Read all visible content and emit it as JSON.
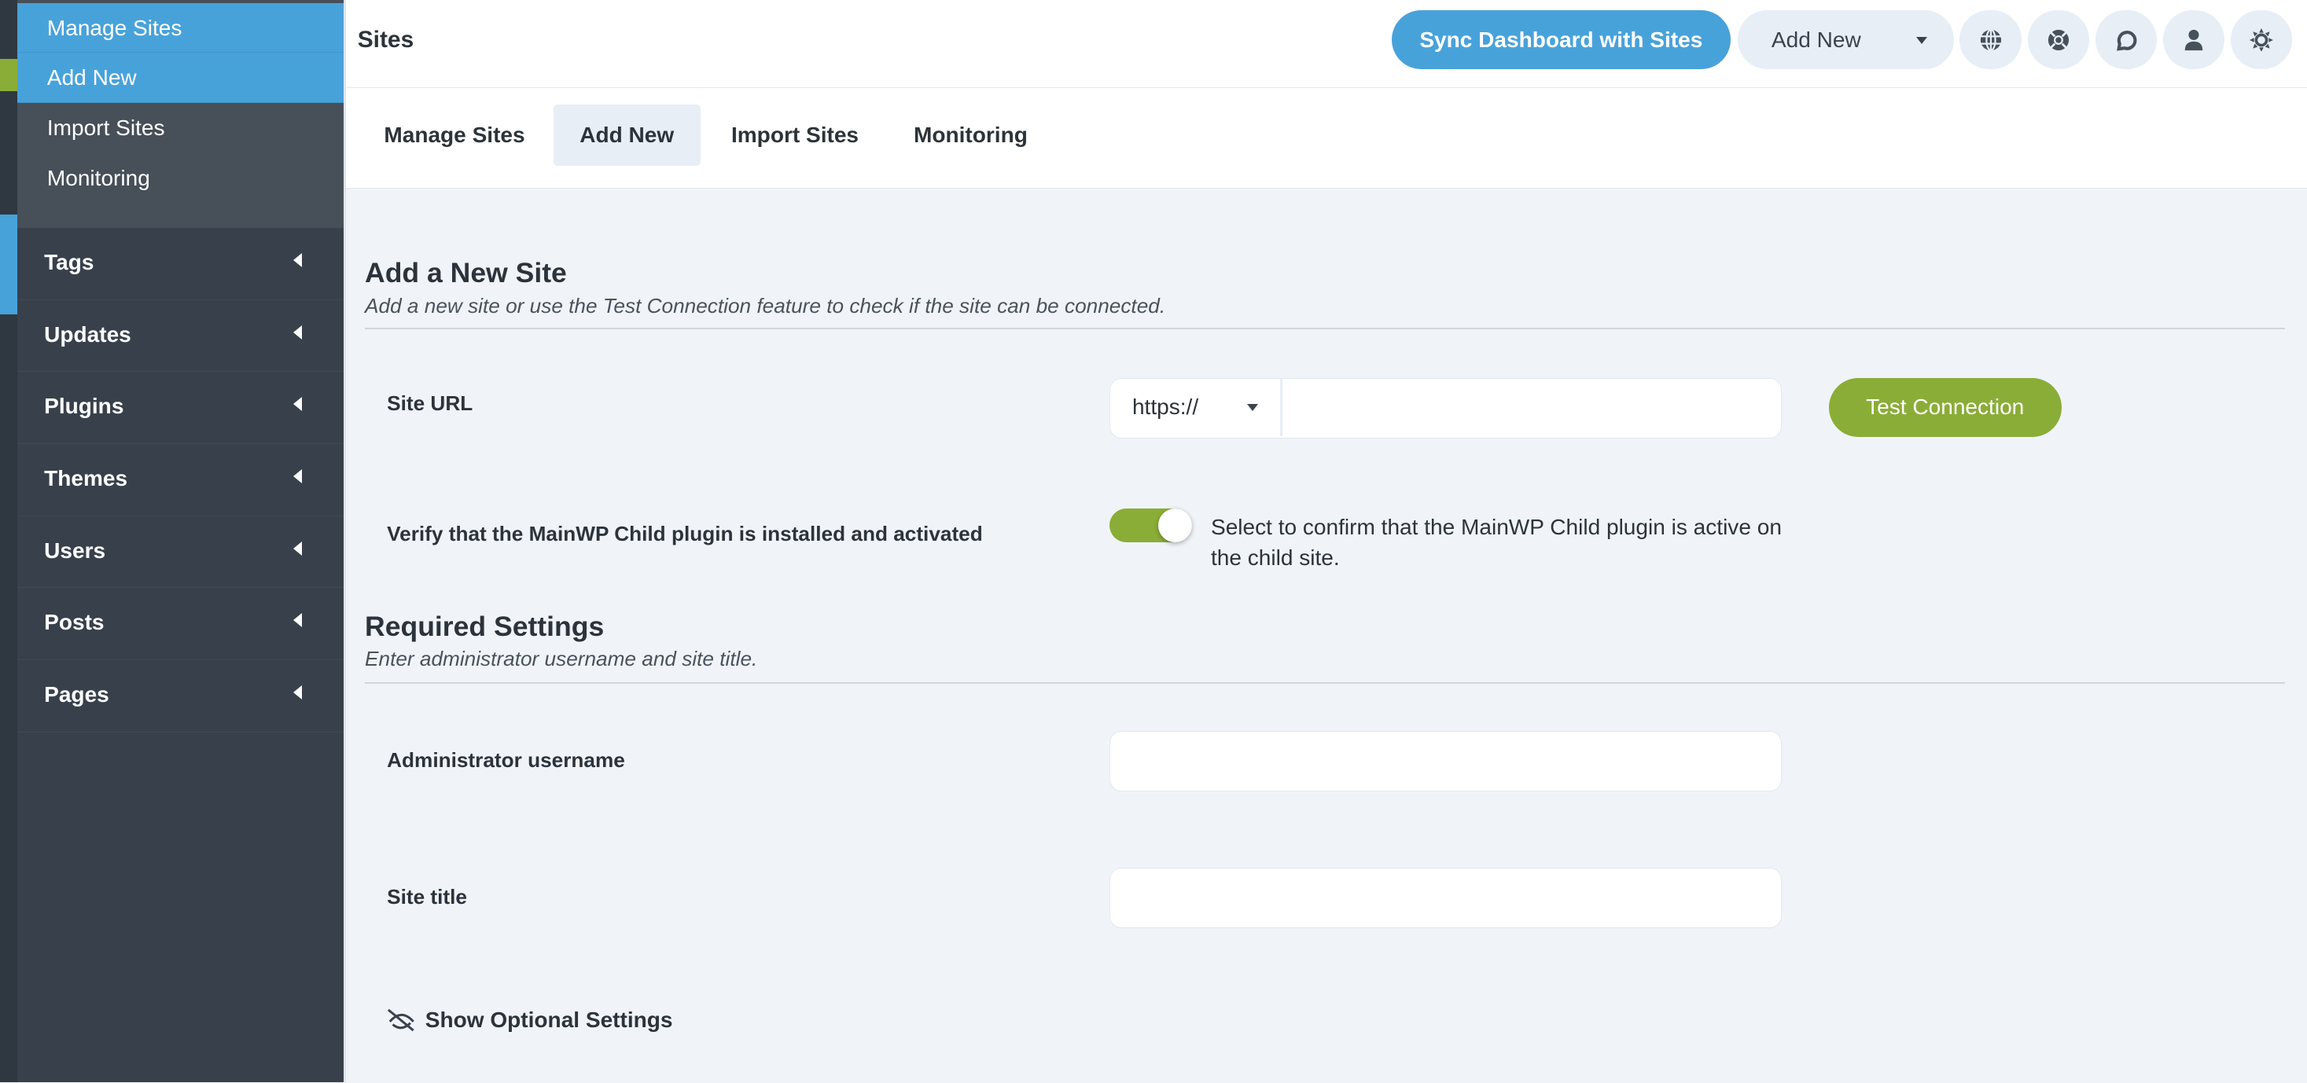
{
  "colors": {
    "primary": "#48a2da",
    "success": "#8aad37",
    "sidebar": "#38414b"
  },
  "sidebar": {
    "submenu": [
      {
        "label": "Manage Sites",
        "active": true
      },
      {
        "label": "Add New",
        "active": true
      },
      {
        "label": "Import Sites"
      },
      {
        "label": "Monitoring"
      }
    ],
    "menu": [
      {
        "label": "Tags"
      },
      {
        "label": "Updates"
      },
      {
        "label": "Plugins"
      },
      {
        "label": "Themes"
      },
      {
        "label": "Users"
      },
      {
        "label": "Posts"
      },
      {
        "label": "Pages"
      }
    ]
  },
  "header": {
    "title": "Sites",
    "sync_label": "Sync Dashboard with Sites",
    "add_new_label": "Add New",
    "icons": [
      "globe-icon",
      "lifebuoy-icon",
      "chat-icon",
      "user-icon",
      "sun-icon"
    ]
  },
  "tabs": [
    {
      "label": "Manage Sites"
    },
    {
      "label": "Add New",
      "active": true
    },
    {
      "label": "Import Sites"
    },
    {
      "label": "Monitoring"
    }
  ],
  "form": {
    "section1_title": "Add a New Site",
    "section1_desc": "Add a new site or use the Test Connection feature to check if the site can be connected.",
    "site_url_label": "Site URL",
    "protocol": "https://",
    "site_url_value": "",
    "test_connection_label": "Test Connection",
    "verify_label": "Verify that the MainWP Child plugin is installed and activated",
    "verify_text": "Select to confirm that the MainWP Child plugin is active on the child site.",
    "verify_checked": true,
    "section2_title": "Required Settings",
    "section2_desc": "Enter administrator username and site title.",
    "admin_label": "Administrator username",
    "admin_value": "",
    "site_title_label": "Site title",
    "site_title_value": "",
    "optional_label": "Show Optional Settings"
  }
}
